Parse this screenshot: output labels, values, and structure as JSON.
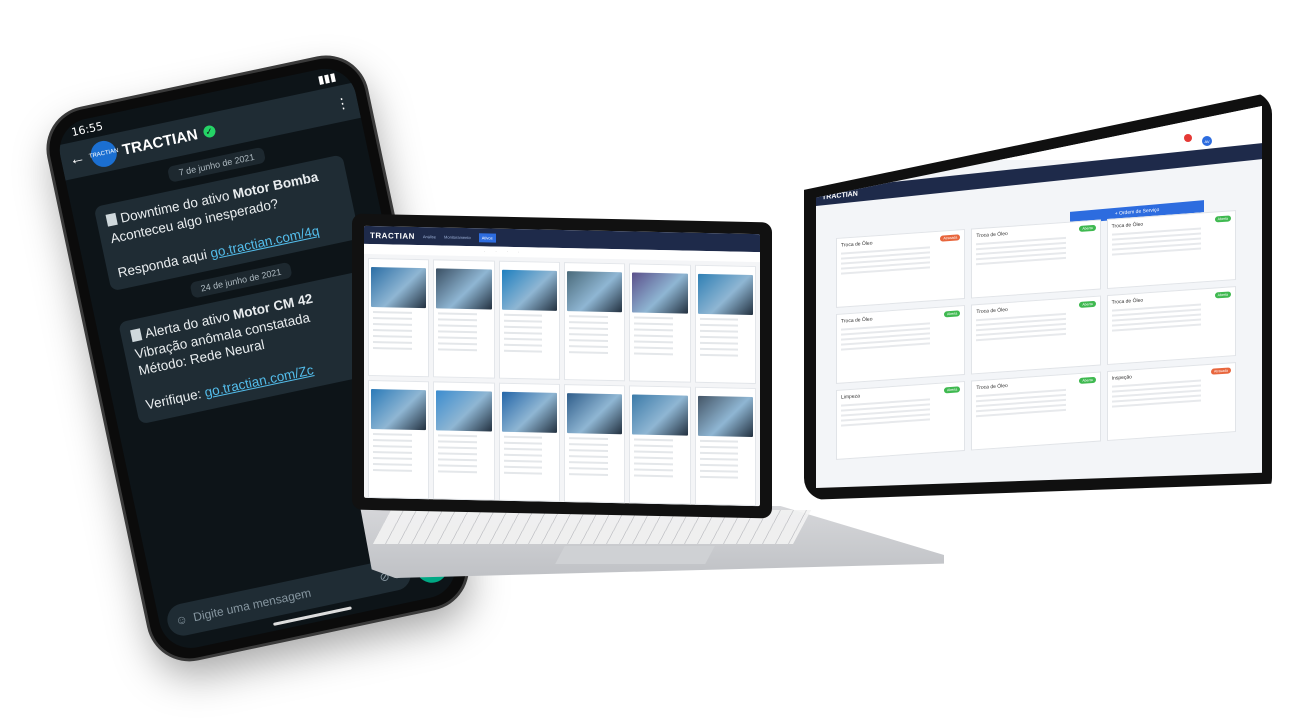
{
  "phone": {
    "status_time": "16:55",
    "contact_name": "TRACTIAN",
    "avatar_text": "TRACTIAN",
    "messages": [
      {
        "date": "7 de junho de 2021",
        "line1": "Downtime do ativo ",
        "asset": "Motor Bomba",
        "line2": "Aconteceu algo inesperado?",
        "cta": "Responda aqui ",
        "link": "go.tractian.com/4q"
      },
      {
        "date": "24 de junho de 2021",
        "line1": "Alerta do ativo ",
        "asset": "Motor CM 42",
        "line2": "Vibração anômala constatada",
        "line3": "Método: Rede Neural",
        "cta": "Verifique: ",
        "link": "go.tractian.com/Zc"
      }
    ],
    "input_placeholder": "Digite uma mensagem"
  },
  "laptop": {
    "brand": "TRACTIAN",
    "nav": [
      "Análise",
      "Monitoramento",
      "Ativos"
    ]
  },
  "tablet": {
    "brand": "TRACTIAN",
    "primary_action": "+ Ordem de Serviço",
    "user_initials": "AV",
    "cards": [
      {
        "title": "Troca de Óleo",
        "badge": "Atrasada",
        "badge_color": "#e8663d"
      },
      {
        "title": "Troca de Óleo",
        "badge": "Aberta",
        "badge_color": "#3fb950"
      },
      {
        "title": "Troca de Óleo",
        "badge": "Aberta",
        "badge_color": "#3fb950"
      },
      {
        "title": "Troca de Óleo",
        "badge": "Aberta",
        "badge_color": "#3fb950"
      },
      {
        "title": "Troca de Óleo",
        "badge": "Aberta",
        "badge_color": "#3fb950"
      },
      {
        "title": "Troca de Óleo",
        "badge": "Aberta",
        "badge_color": "#3fb950"
      },
      {
        "title": "Limpeza",
        "badge": "Aberta",
        "badge_color": "#3fb950"
      },
      {
        "title": "Troca de Óleo",
        "badge": "Aberta",
        "badge_color": "#3fb950"
      },
      {
        "title": "Inspeção",
        "badge": "Atrasada",
        "badge_color": "#e8663d"
      }
    ]
  }
}
